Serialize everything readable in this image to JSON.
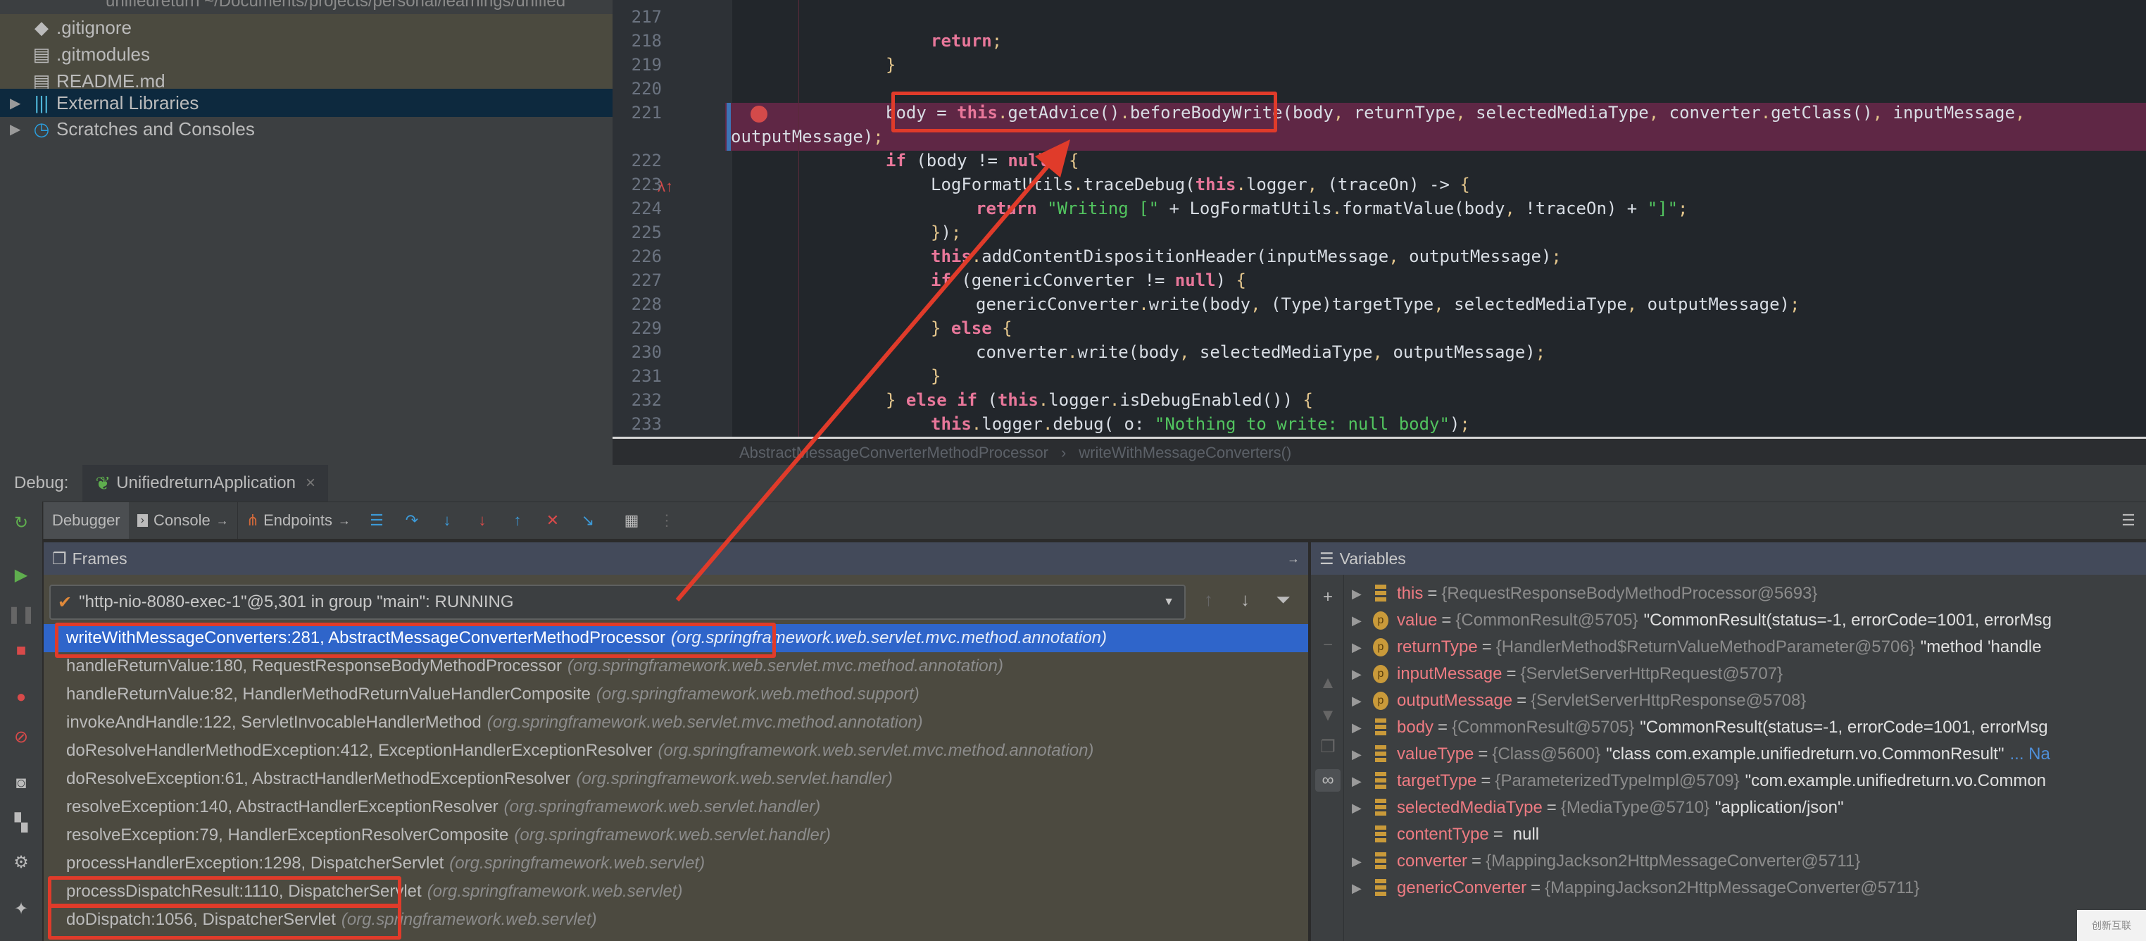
{
  "project_tree": {
    "root_partial": "unifiedreturn ~/Documents/projects/personal/learnings/unified",
    "items": [
      {
        "label": ".gitignore",
        "icon": "git-icon"
      },
      {
        "label": ".gitmodules",
        "icon": "file-icon"
      },
      {
        "label": "README.md",
        "icon": "file-icon"
      },
      {
        "label": "External Libraries",
        "icon": "library-icon",
        "selected": true
      },
      {
        "label": "Scratches and Consoles",
        "icon": "scratch-icon"
      }
    ]
  },
  "editor": {
    "lines": [
      {
        "num": "217",
        "code": ""
      },
      {
        "num": "218",
        "code": "return;"
      },
      {
        "num": "219",
        "code": "}"
      },
      {
        "num": "220",
        "code": ""
      },
      {
        "num": "221",
        "code": "body = this.getAdvice().beforeBodyWrite(body, returnType, selectedMediaType, converter.getClass(), inputMessage,"
      },
      {
        "num": "",
        "code": "outputMessage);"
      },
      {
        "num": "222",
        "code": "if (body != null) {"
      },
      {
        "num": "223",
        "code": "LogFormatUtils.traceDebug(this.logger, (traceOn) -> {"
      },
      {
        "num": "224",
        "code": "return \"Writing [\" + LogFormatUtils.formatValue(body, !traceOn) + \"]\";"
      },
      {
        "num": "225",
        "code": "});"
      },
      {
        "num": "226",
        "code": "this.addContentDispositionHeader(inputMessage, outputMessage);"
      },
      {
        "num": "227",
        "code": "if (genericConverter != null) {"
      },
      {
        "num": "228",
        "code": "genericConverter.write(body, (Type)targetType, selectedMediaType, outputMessage);"
      },
      {
        "num": "229",
        "code": "} else {"
      },
      {
        "num": "230",
        "code": "converter.write(body, selectedMediaType, outputMessage);"
      },
      {
        "num": "231",
        "code": "}"
      },
      {
        "num": "232",
        "code": "} else if (this.logger.isDebugEnabled()) {"
      },
      {
        "num": "233",
        "code": "this.logger.debug( o: \"Nothing to write: null body\");"
      }
    ],
    "breadcrumb": [
      "AbstractMessageConverterMethodProcessor",
      "writeWithMessageConverters()"
    ]
  },
  "debug": {
    "label": "Debug:",
    "session_tab": "UnifiedreturnApplication",
    "tabs": [
      "Debugger",
      "Console",
      "Endpoints"
    ],
    "frames_title": "Frames",
    "variables_title": "Variables",
    "thread": "\"http-nio-8080-exec-1\"@5,301 in group \"main\": RUNNING",
    "frames": [
      {
        "method": "writeWithMessageConverters:281, AbstractMessageConverterMethodProcessor",
        "pkg": "(org.springframework.web.servlet.mvc.method.annotation)",
        "selected": true
      },
      {
        "method": "handleReturnValue:180, RequestResponseBodyMethodProcessor",
        "pkg": "(org.springframework.web.servlet.mvc.method.annotation)"
      },
      {
        "method": "handleReturnValue:82, HandlerMethodReturnValueHandlerComposite",
        "pkg": "(org.springframework.web.method.support)"
      },
      {
        "method": "invokeAndHandle:122, ServletInvocableHandlerMethod",
        "pkg": "(org.springframework.web.servlet.mvc.method.annotation)"
      },
      {
        "method": "doResolveHandlerMethodException:412, ExceptionHandlerExceptionResolver",
        "pkg": "(org.springframework.web.servlet.mvc.method.annotation)"
      },
      {
        "method": "doResolveException:61, AbstractHandlerMethodExceptionResolver",
        "pkg": "(org.springframework.web.servlet.handler)"
      },
      {
        "method": "resolveException:140, AbstractHandlerExceptionResolver",
        "pkg": "(org.springframework.web.servlet.handler)"
      },
      {
        "method": "resolveException:79, HandlerExceptionResolverComposite",
        "pkg": "(org.springframework.web.servlet.handler)"
      },
      {
        "method": "processHandlerException:1298, DispatcherServlet",
        "pkg": "(org.springframework.web.servlet)"
      },
      {
        "method": "processDispatchResult:1110, DispatcherServlet",
        "pkg": "(org.springframework.web.servlet)"
      },
      {
        "method": "doDispatch:1056, DispatcherServlet",
        "pkg": "(org.springframework.web.servlet)"
      }
    ],
    "variables": [
      {
        "name": "this",
        "ref": "{RequestResponseBodyMethodProcessor@5693}",
        "val": "",
        "kind": "field",
        "expandable": true
      },
      {
        "name": "value",
        "ref": "{CommonResult@5705}",
        "val": "\"CommonResult(status=-1, errorCode=1001, errorMsg",
        "kind": "param",
        "expandable": true
      },
      {
        "name": "returnType",
        "ref": "{HandlerMethod$ReturnValueMethodParameter@5706}",
        "val": "\"method 'handle",
        "kind": "param",
        "expandable": true
      },
      {
        "name": "inputMessage",
        "ref": "{ServletServerHttpRequest@5707}",
        "val": "",
        "kind": "param",
        "expandable": true
      },
      {
        "name": "outputMessage",
        "ref": "{ServletServerHttpResponse@5708}",
        "val": "",
        "kind": "param",
        "expandable": true
      },
      {
        "name": "body",
        "ref": "{CommonResult@5705}",
        "val": "\"CommonResult(status=-1, errorCode=1001, errorMsg",
        "kind": "field",
        "expandable": true
      },
      {
        "name": "valueType",
        "ref": "{Class@5600}",
        "val": "\"class com.example.unifiedreturn.vo.CommonResult\"",
        "more": "... Na",
        "kind": "field",
        "expandable": true
      },
      {
        "name": "targetType",
        "ref": "{ParameterizedTypeImpl@5709}",
        "val": "\"com.example.unifiedreturn.vo.Common",
        "kind": "field",
        "expandable": true
      },
      {
        "name": "selectedMediaType",
        "ref": "{MediaType@5710}",
        "val": "\"application/json\"",
        "kind": "field",
        "expandable": true
      },
      {
        "name": "contentType",
        "ref": "",
        "val": "null",
        "kind": "field",
        "expandable": false
      },
      {
        "name": "converter",
        "ref": "{MappingJackson2HttpMessageConverter@5711}",
        "val": "",
        "kind": "field",
        "expandable": true
      },
      {
        "name": "genericConverter",
        "ref": "{MappingJackson2HttpMessageConverter@5711}",
        "val": "",
        "kind": "field",
        "expandable": true
      }
    ]
  },
  "watermark": "创新互联",
  "colors": {
    "annotation": "#e03b2a",
    "selection": "#2f65ca",
    "breakpoint_line": "#5f2745"
  }
}
